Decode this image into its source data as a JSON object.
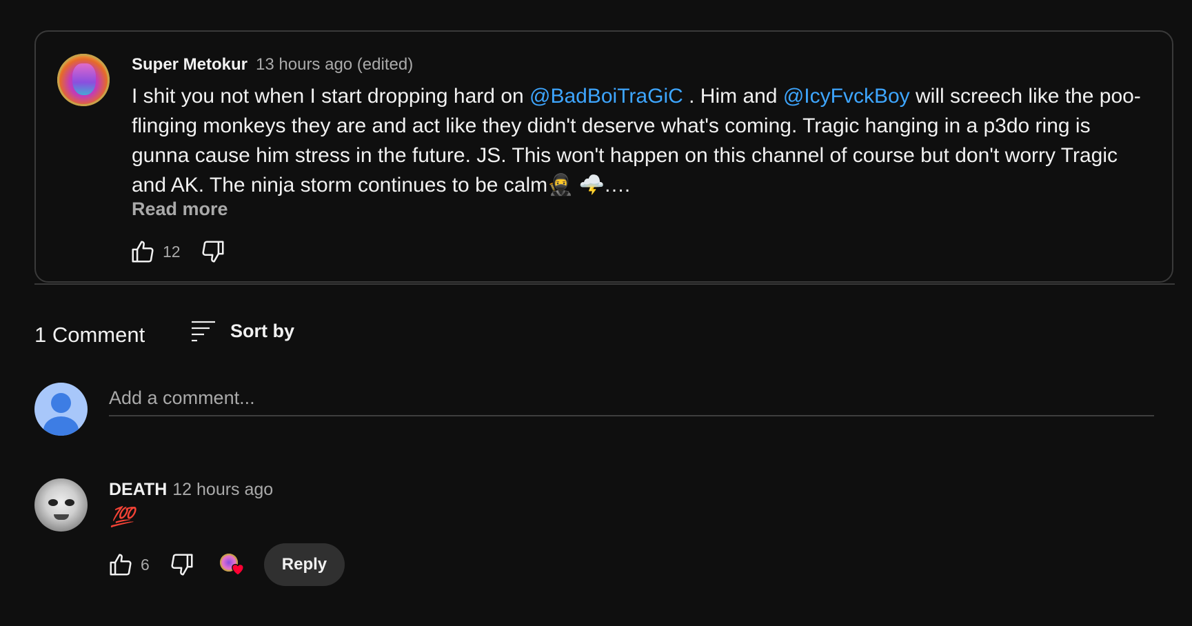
{
  "main_comment": {
    "author": "Super Metokur",
    "meta": "13 hours ago (edited)",
    "text_parts": [
      "I shit you not when I start dropping hard on ",
      "@BadBoiTraGiC",
      " . Him and ",
      "@IcyFvckBoy",
      " will screech like the poo-flinging monkeys they are and act like they didn't deserve what's coming. Tragic hanging in a p3do ring is gunna cause him stress in the future. JS. This won't happen on this channel of course but don't worry Tragic and AK. The ninja storm continues to be calm🥷 🌩️.…"
    ],
    "read_more": "Read more",
    "like_count": "12"
  },
  "comments_header": {
    "count_label": "1 Comment",
    "sort_label": "Sort by"
  },
  "add_comment": {
    "placeholder": "Add a comment..."
  },
  "reply": {
    "author": "DEATH",
    "meta": "12 hours ago",
    "text": "💯",
    "like_count": "6",
    "reply_label": "Reply"
  },
  "colors": {
    "background": "#0f0f0f",
    "mention": "#3ea6ff",
    "secondary_text": "#aaaaaa",
    "heart": "#ff0033"
  },
  "icons": [
    "thumbs-up-icon",
    "thumbs-down-icon",
    "sort-icon",
    "heart-icon",
    "user-avatar-icon"
  ]
}
